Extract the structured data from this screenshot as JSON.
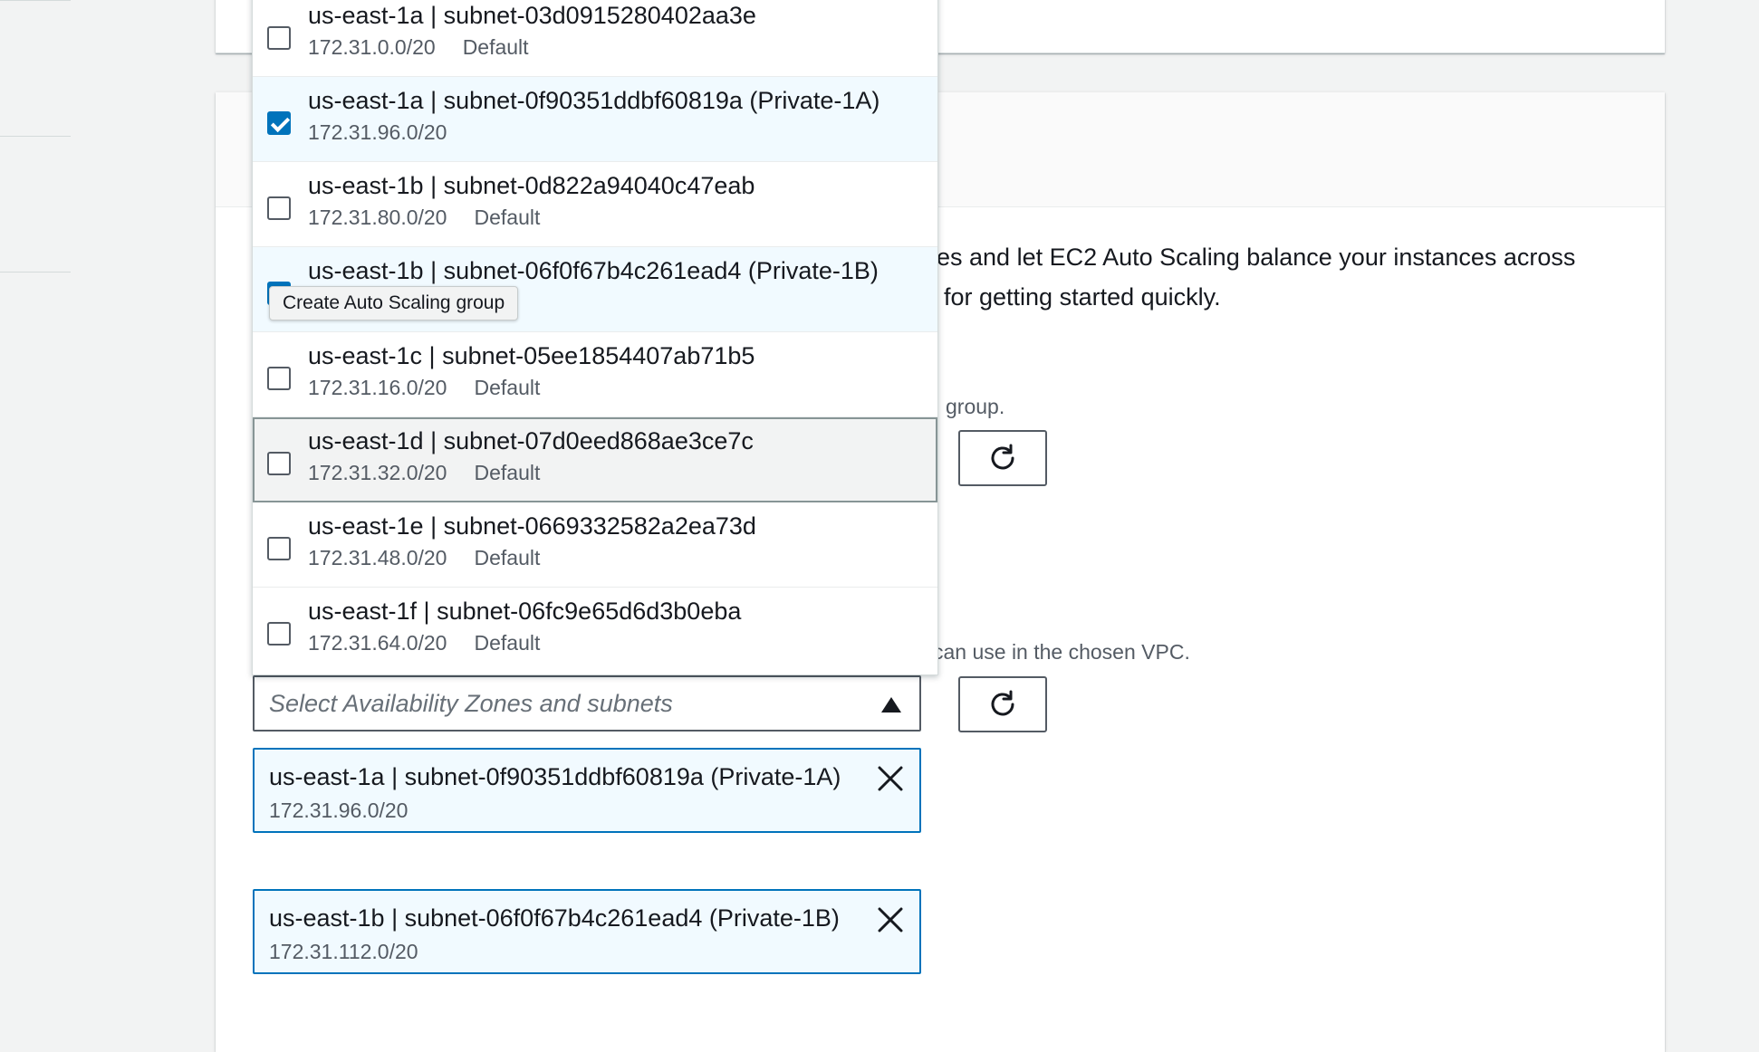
{
  "page": {
    "description_line_1_fragment": "es and let EC2 Auto Scaling balance your instances across",
    "description_line_2_fragment": "for getting started quickly.",
    "launch_template_hint_fragment": "group.",
    "network_hint_fragment": "can use in the chosen VPC."
  },
  "subnet_dropdown": {
    "options": [
      {
        "title": "us-east-1a | subnet-03d0915280402aa3e",
        "cidr": "172.31.0.0/20",
        "tag": "Default",
        "checked": false
      },
      {
        "title": "us-east-1a | subnet-0f90351ddbf60819a (Private-1A)",
        "cidr": "172.31.96.0/20",
        "tag": "",
        "checked": true
      },
      {
        "title": "us-east-1b | subnet-0d822a94040c47eab",
        "cidr": "172.31.80.0/20",
        "tag": "Default",
        "checked": false
      },
      {
        "title": "us-east-1b | subnet-06f0f67b4c261ead4 (Private-1B)",
        "cidr": "",
        "tag": "",
        "checked": true
      },
      {
        "title": "us-east-1c | subnet-05ee1854407ab71b5",
        "cidr": "172.31.16.0/20",
        "tag": "Default",
        "checked": false
      },
      {
        "title": "us-east-1d | subnet-07d0eed868ae3ce7c",
        "cidr": "172.31.32.0/20",
        "tag": "Default",
        "checked": false
      },
      {
        "title": "us-east-1e | subnet-0669332582a2ea73d",
        "cidr": "172.31.48.0/20",
        "tag": "Default",
        "checked": false
      },
      {
        "title": "us-east-1f | subnet-06fc9e65d6d3b0eba",
        "cidr": "172.31.64.0/20",
        "tag": "Default",
        "checked": false
      }
    ],
    "tooltip": "Create Auto Scaling group"
  },
  "subnet_select": {
    "placeholder": "Select Availability Zones and subnets"
  },
  "selected_tokens": [
    {
      "title": "us-east-1a | subnet-0f90351ddbf60819a (Private-1A)",
      "cidr": "172.31.96.0/20"
    },
    {
      "title": "us-east-1b | subnet-06f0f67b4c261ead4 (Private-1B)",
      "cidr": "172.31.112.0/20"
    }
  ],
  "icons": {
    "refresh": "refresh-icon",
    "remove": "close-icon",
    "caret": "caret-up-icon"
  },
  "colors": {
    "accent": "#0073bb",
    "selected_bg": "#f1faff",
    "text": "#16191f",
    "secondary_text": "#545b64"
  }
}
